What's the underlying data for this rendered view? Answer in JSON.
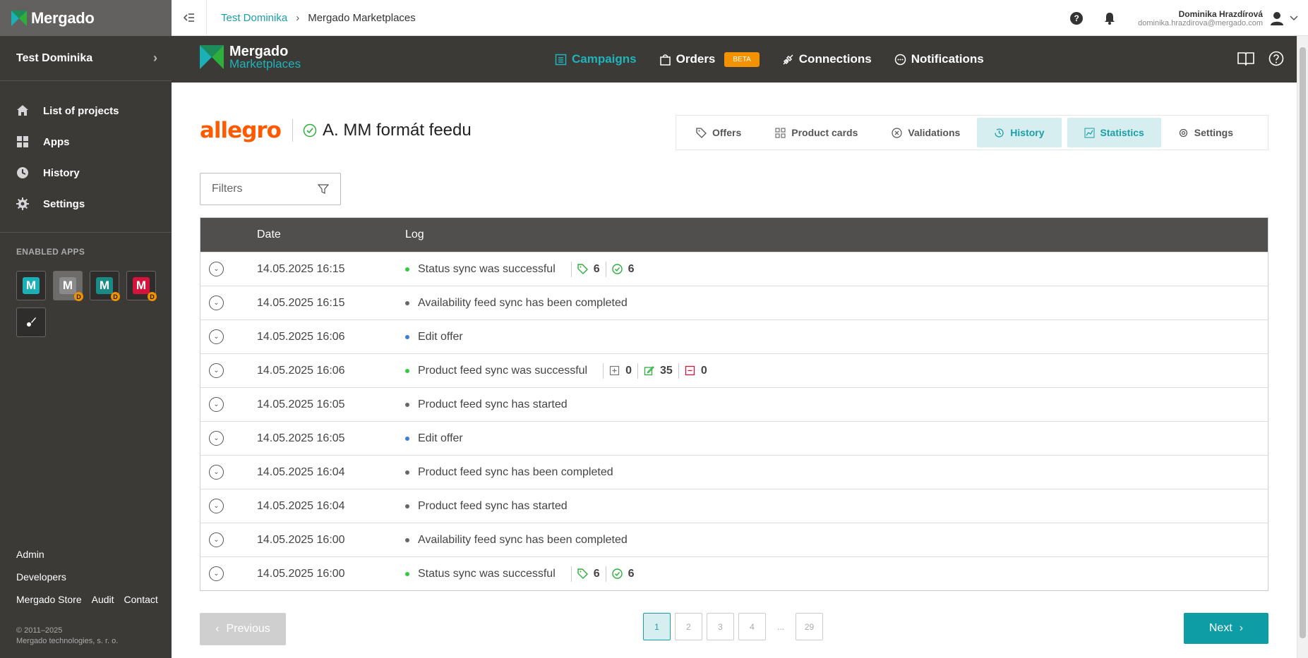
{
  "brand": {
    "name": "Mergado",
    "copyright_line1": "© 2011–2025",
    "copyright_line2": "Mergado technologies, s. r. o."
  },
  "sidebar": {
    "project": "Test Dominika",
    "items": [
      {
        "label": "List of projects",
        "icon": "home-icon"
      },
      {
        "label": "Apps",
        "icon": "apps-grid-icon"
      },
      {
        "label": "History",
        "icon": "history-icon"
      },
      {
        "label": "Settings",
        "icon": "gear-icon"
      }
    ],
    "enabled_apps_title": "ENABLED APPS",
    "apps": [
      {
        "letter": "M",
        "color": "#1ab0b6",
        "badge": ""
      },
      {
        "letter": "M",
        "color": "#8a8a8a",
        "badge": "D"
      },
      {
        "letter": "M",
        "color": "#1a8a86",
        "badge": "D"
      },
      {
        "letter": "M",
        "color": "#d4143c",
        "badge": "D"
      }
    ],
    "footer": {
      "admin": "Admin",
      "developers": "Developers",
      "store": "Mergado Store",
      "audit": "Audit",
      "contact": "Contact"
    }
  },
  "topbar": {
    "breadcrumb_link": "Test Dominika",
    "breadcrumb_current": "Mergado Marketplaces",
    "user_name": "Dominika Hrazdírová",
    "user_email": "dominika.hrazdirova@mergado.com"
  },
  "app_header": {
    "logo_line1": "Mergado",
    "logo_line2": "Marketplaces",
    "nav": {
      "campaigns": "Campaigns",
      "orders": "Orders",
      "beta": "BETA",
      "connections": "Connections",
      "notifications": "Notifications"
    }
  },
  "campaign": {
    "marketplace": "allegro",
    "name": "A. MM formát feedu",
    "tabs": {
      "offers": "Offers",
      "product_cards": "Product cards",
      "validations": "Validations",
      "history": "History",
      "statistics": "Statistics",
      "settings": "Settings"
    }
  },
  "filters": {
    "label": "Filters"
  },
  "table": {
    "headers": {
      "date": "Date",
      "log": "Log"
    },
    "rows": [
      {
        "date": "14.05.2025 16:15",
        "log": "Status sync was successful",
        "dot": "#2ecc40",
        "stats": [
          {
            "icon": "tag-icon",
            "value": "6",
            "color": "#2eae3c"
          },
          {
            "icon": "check-circle-icon",
            "value": "6",
            "color": "#2eae3c"
          }
        ]
      },
      {
        "date": "14.05.2025 16:15",
        "log": "Availability feed sync has been completed",
        "dot": "#666666",
        "stats": []
      },
      {
        "date": "14.05.2025 16:06",
        "log": "Edit offer",
        "dot": "#3a7ddc",
        "stats": []
      },
      {
        "date": "14.05.2025 16:06",
        "log": "Product feed sync was successful",
        "dot": "#2ecc40",
        "stats": [
          {
            "icon": "add-box-icon",
            "value": "0",
            "color": "#777777"
          },
          {
            "icon": "edit-icon",
            "value": "35",
            "color": "#2eae3c"
          },
          {
            "icon": "minus-box-icon",
            "value": "0",
            "color": "#d4143c"
          }
        ]
      },
      {
        "date": "14.05.2025 16:05",
        "log": "Product feed sync has started",
        "dot": "#666666",
        "stats": []
      },
      {
        "date": "14.05.2025 16:05",
        "log": "Edit offer",
        "dot": "#3a7ddc",
        "stats": []
      },
      {
        "date": "14.05.2025 16:04",
        "log": "Product feed sync has been completed",
        "dot": "#666666",
        "stats": []
      },
      {
        "date": "14.05.2025 16:04",
        "log": "Product feed sync has started",
        "dot": "#666666",
        "stats": []
      },
      {
        "date": "14.05.2025 16:00",
        "log": "Availability feed sync has been completed",
        "dot": "#666666",
        "stats": []
      },
      {
        "date": "14.05.2025 16:00",
        "log": "Status sync was successful",
        "dot": "#2ecc40",
        "stats": [
          {
            "icon": "tag-icon",
            "value": "6",
            "color": "#2eae3c"
          },
          {
            "icon": "check-circle-icon",
            "value": "6",
            "color": "#2eae3c"
          }
        ]
      }
    ]
  },
  "pagination": {
    "previous": "Previous",
    "next": "Next",
    "pages": [
      "1",
      "2",
      "3",
      "4",
      "...",
      "29"
    ],
    "current": "1"
  }
}
